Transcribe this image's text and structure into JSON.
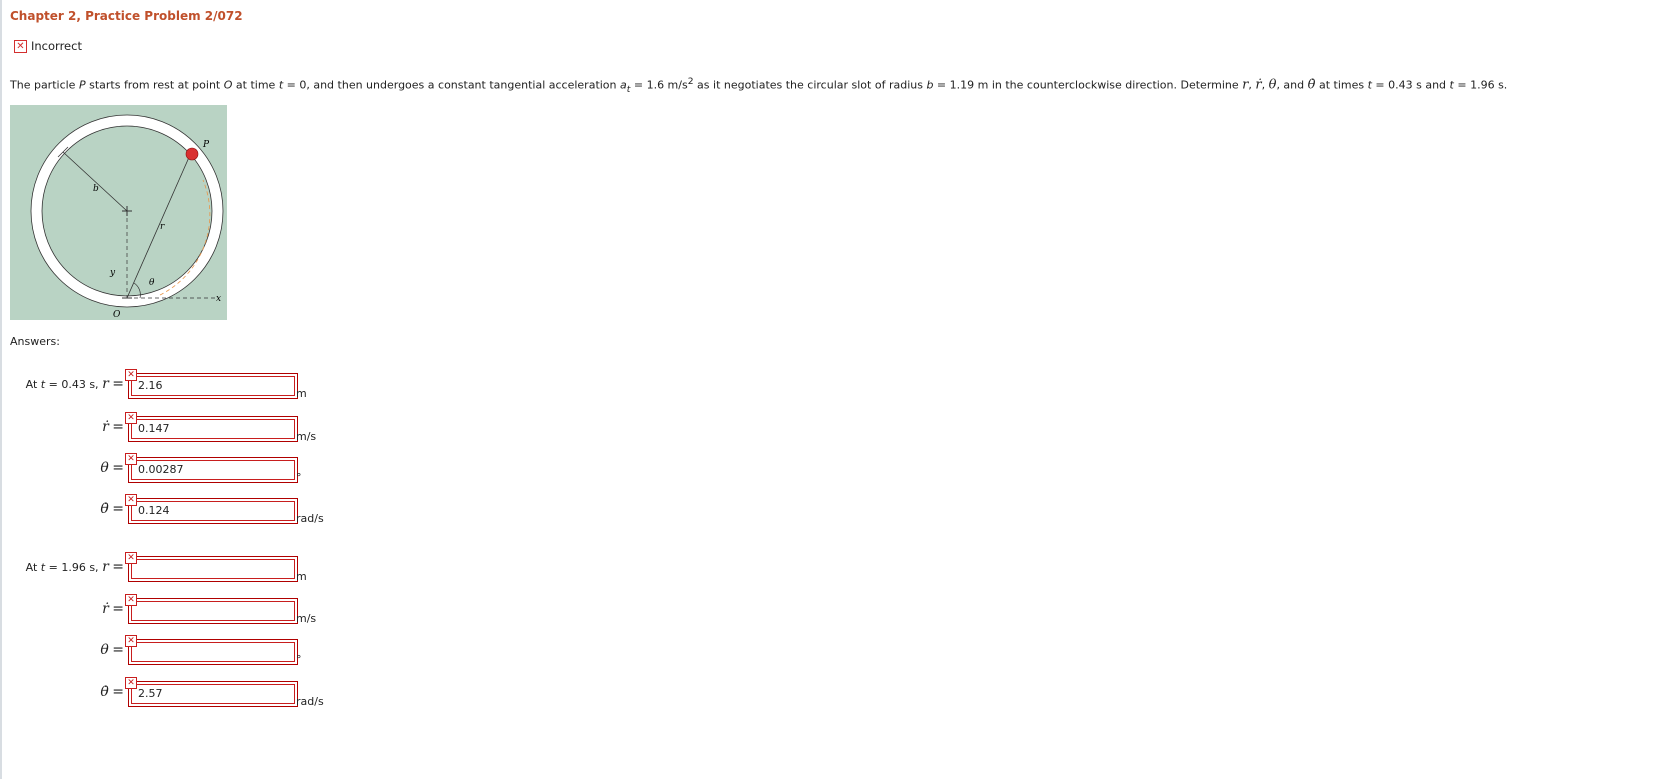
{
  "title": "Chapter 2, Practice Problem 2/072",
  "status": {
    "icon": "x-icon",
    "label": "Incorrect"
  },
  "problem": {
    "p1": "The particle ",
    "P": "P",
    "p2": " starts from rest at point ",
    "O": "O",
    "p3": " at time ",
    "t": "t",
    "p4": " = 0, and then undergoes a constant tangential acceleration ",
    "a": "a",
    "sub": "t",
    "p5": " = 1.6 m/s",
    "sup": "2",
    "p6": " as it negotiates the circular slot of radius ",
    "b": "b",
    "p7": " = 1.19 m in the counterclockwise direction. Determine ",
    "r": "r",
    "c1": ", ",
    "rdot": "ṙ",
    "c2": ", ",
    "theta": "θ",
    "c3": ", and ",
    "thetadot": "θ̇",
    "p8": " at times ",
    "t1": "t",
    "p9": " = 0.43 s and ",
    "t2": "t",
    "p10": " = 1.96 s."
  },
  "figure": {
    "P": "P",
    "b": "b",
    "r": "r",
    "y": "y",
    "theta": "θ",
    "x": "x",
    "O": "O"
  },
  "answers_label": "Answers:",
  "groups": [
    {
      "prefix": "At ",
      "t": "t",
      "time": " = 0.43  s,",
      "rows": [
        {
          "sym": "r",
          "value": "2.16",
          "unit": "m"
        },
        {
          "sym": "ṙ",
          "value": "0.147",
          "unit": "m/s"
        },
        {
          "sym": "θ",
          "value": "0.00287",
          "unit": "°"
        },
        {
          "sym": "θ̇",
          "value": "0.124",
          "unit": "rad/s"
        }
      ]
    },
    {
      "prefix": "At ",
      "t": "t",
      "time": " = 1.96  s,",
      "rows": [
        {
          "sym": "r",
          "value": "",
          "unit": "m"
        },
        {
          "sym": "ṙ",
          "value": "",
          "unit": "m/s"
        },
        {
          "sym": "θ",
          "value": "",
          "unit": "°"
        },
        {
          "sym": "θ̇",
          "value": "2.57",
          "unit": "rad/s"
        }
      ]
    }
  ],
  "eq": "=",
  "error_icon": "x-icon",
  "colors": {
    "title": "#c0502b",
    "error": "#c81e1e",
    "figure_bg": "#b9d3c4",
    "particle": "#d93030"
  }
}
